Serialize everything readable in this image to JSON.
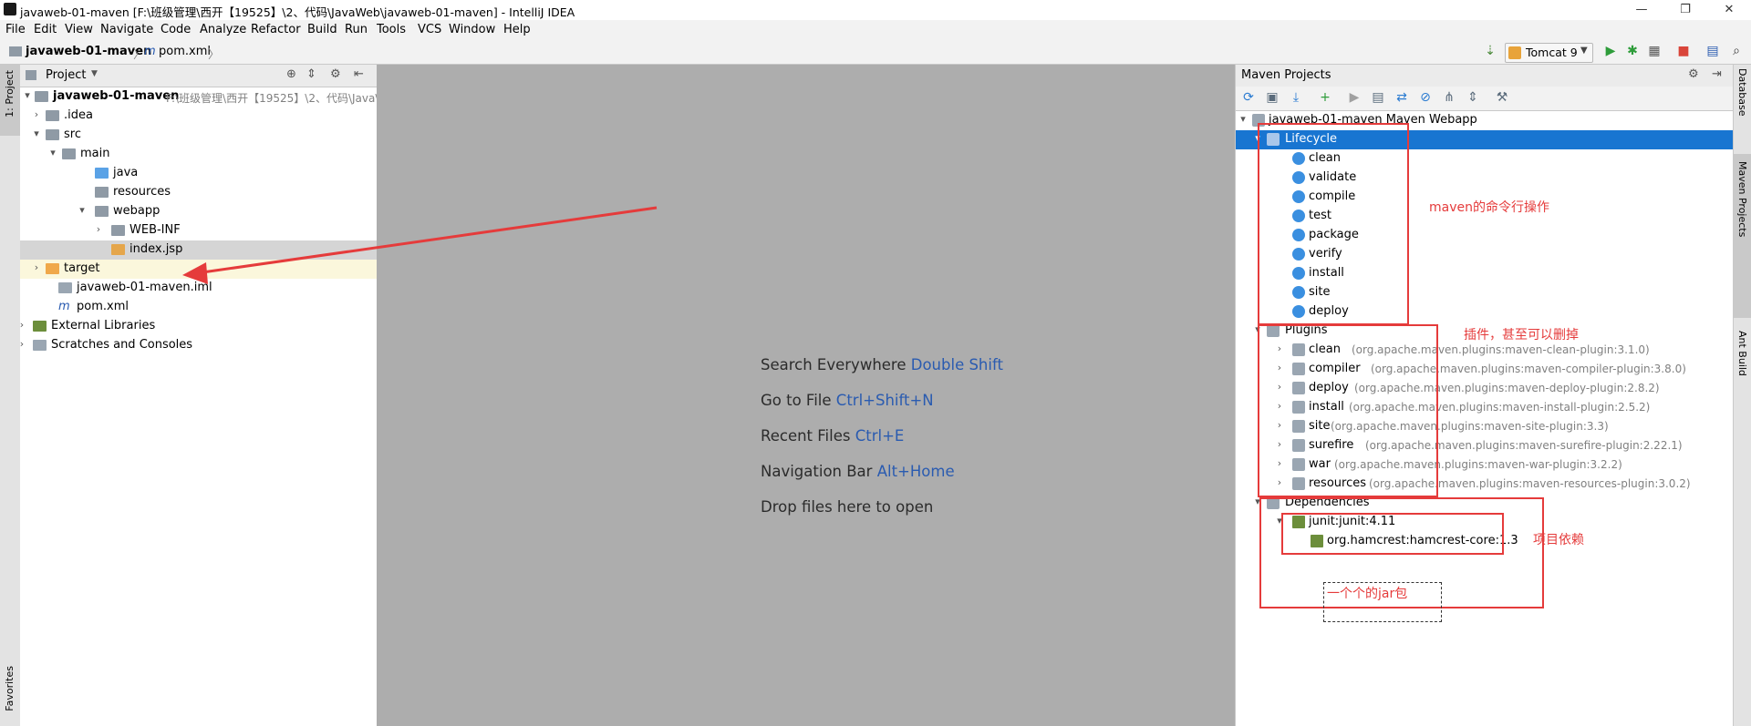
{
  "window": {
    "title": "javaweb-01-maven [F:\\班级管理\\西开【19525】\\2、代码\\JavaWeb\\javaweb-01-maven] - IntelliJ IDEA",
    "minimize": "—",
    "maximize": "❐",
    "close": "✕"
  },
  "menu": [
    "File",
    "Edit",
    "View",
    "Navigate",
    "Code",
    "Analyze",
    "Refactor",
    "Build",
    "Run",
    "Tools",
    "VCS",
    "Window",
    "Help"
  ],
  "breadcrumb": {
    "project": "javaweb-01-maven",
    "sep": "〉",
    "file": "pom.xml"
  },
  "run_config": {
    "label": "Tomcat 9"
  },
  "left_strip": {
    "project_tab": "1: Project",
    "favorites_tab": "Favorites"
  },
  "project_panel": {
    "header": "Project",
    "tree": [
      {
        "label": "javaweb-01-maven",
        "path": "F:\\班级管理\\西开【19525】\\2、代码\\Java\\"
      },
      {
        "label": ".idea"
      },
      {
        "label": "src"
      },
      {
        "label": "main"
      },
      {
        "label": "java"
      },
      {
        "label": "resources"
      },
      {
        "label": "webapp"
      },
      {
        "label": "WEB-INF"
      },
      {
        "label": "index.jsp"
      },
      {
        "label": "target"
      },
      {
        "label": "javaweb-01-maven.iml"
      },
      {
        "label": "pom.xml"
      },
      {
        "label": "External Libraries"
      },
      {
        "label": "Scratches and Consoles"
      }
    ]
  },
  "editor_hints": [
    {
      "text": "Search Everywhere",
      "key": "Double Shift"
    },
    {
      "text": "Go to File",
      "key": "Ctrl+Shift+N"
    },
    {
      "text": "Recent Files",
      "key": "Ctrl+E"
    },
    {
      "text": "Navigation Bar",
      "key": "Alt+Home"
    },
    {
      "text": "Drop files here to open",
      "key": ""
    }
  ],
  "maven_panel": {
    "header": "Maven Projects",
    "root": "javaweb-01-maven Maven Webapp",
    "lifecycle_label": "Lifecycle",
    "lifecycle": [
      "clean",
      "validate",
      "compile",
      "test",
      "package",
      "verify",
      "install",
      "site",
      "deploy"
    ],
    "plugins_label": "Plugins",
    "plugins": [
      {
        "name": "clean",
        "coord": "(org.apache.maven.plugins:maven-clean-plugin:3.1.0)"
      },
      {
        "name": "compiler",
        "coord": "(org.apache.maven.plugins:maven-compiler-plugin:3.8.0)"
      },
      {
        "name": "deploy",
        "coord": "(org.apache.maven.plugins:maven-deploy-plugin:2.8.2)"
      },
      {
        "name": "install",
        "coord": "(org.apache.maven.plugins:maven-install-plugin:2.5.2)"
      },
      {
        "name": "site",
        "coord": "(org.apache.maven.plugins:maven-site-plugin:3.3)"
      },
      {
        "name": "surefire",
        "coord": "(org.apache.maven.plugins:maven-surefire-plugin:2.22.1)"
      },
      {
        "name": "war",
        "coord": "(org.apache.maven.plugins:maven-war-plugin:3.2.2)"
      },
      {
        "name": "resources",
        "coord": "(org.apache.maven.plugins:maven-resources-plugin:3.0.2)"
      }
    ],
    "dependencies_label": "Dependencies",
    "dependencies": [
      "junit:junit:4.11",
      "org.hamcrest:hamcrest-core:1.3"
    ]
  },
  "right_strip": {
    "tabs": [
      "Database",
      "Maven Projects",
      "Ant Build"
    ]
  },
  "annotations": {
    "lifecycle_note": "maven的命令行操作",
    "plugins_note": "插件，甚至可以删掉",
    "deps_note": "项目依赖",
    "jar_note": "一个个的jar包"
  },
  "colors": {
    "annotation": "#e53b3b",
    "selection": "#1875d1",
    "editor_bg": "#adadad"
  }
}
